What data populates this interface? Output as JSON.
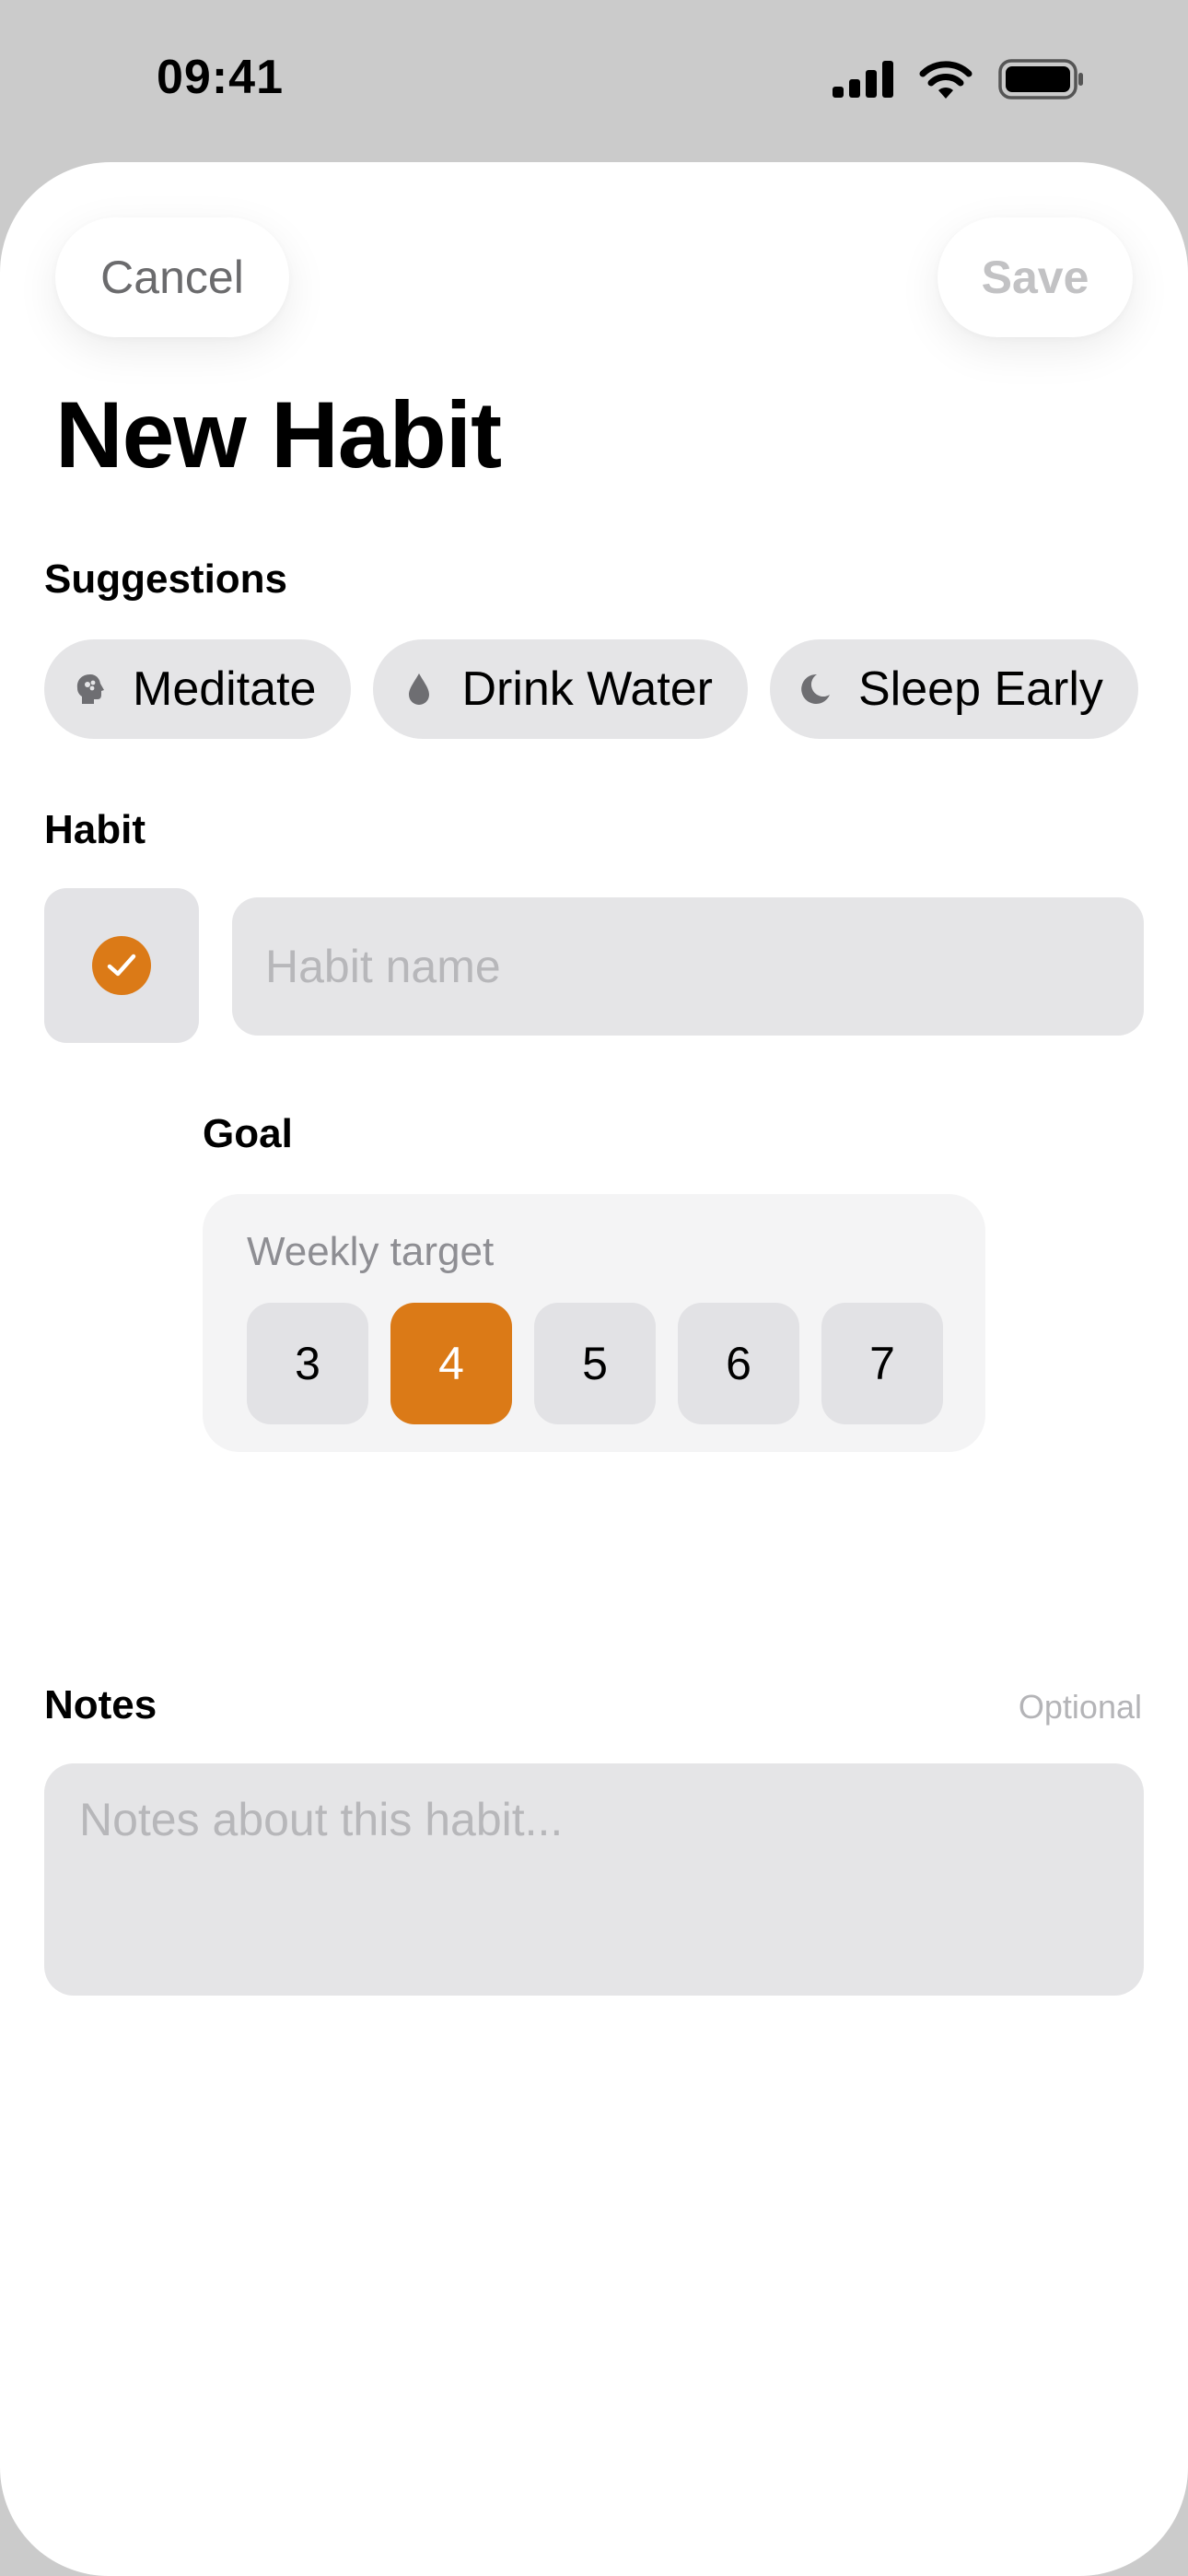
{
  "status_bar": {
    "time": "09:41"
  },
  "nav": {
    "cancel_label": "Cancel",
    "save_label": "Save"
  },
  "title": "New Habit",
  "suggestions": {
    "label": "Suggestions",
    "items": [
      {
        "label": "Meditate",
        "icon": "brain-head-icon"
      },
      {
        "label": "Drink Water",
        "icon": "water-drop-icon"
      },
      {
        "label": "Sleep Early",
        "icon": "moon-icon"
      }
    ]
  },
  "habit": {
    "label": "Habit",
    "icon": "checkmark-circle-icon",
    "name_value": "",
    "name_placeholder": "Habit name"
  },
  "goal": {
    "label": "Goal",
    "sublabel": "Weekly target",
    "options": [
      "3",
      "4",
      "5",
      "6",
      "7"
    ],
    "selected": "4"
  },
  "notes": {
    "label": "Notes",
    "optional_label": "Optional",
    "value": "",
    "placeholder": "Notes about this habit..."
  },
  "colors": {
    "accent": "#db7a17",
    "field_bg": "#e5e5e7",
    "placeholder": "#b7b7ba"
  }
}
